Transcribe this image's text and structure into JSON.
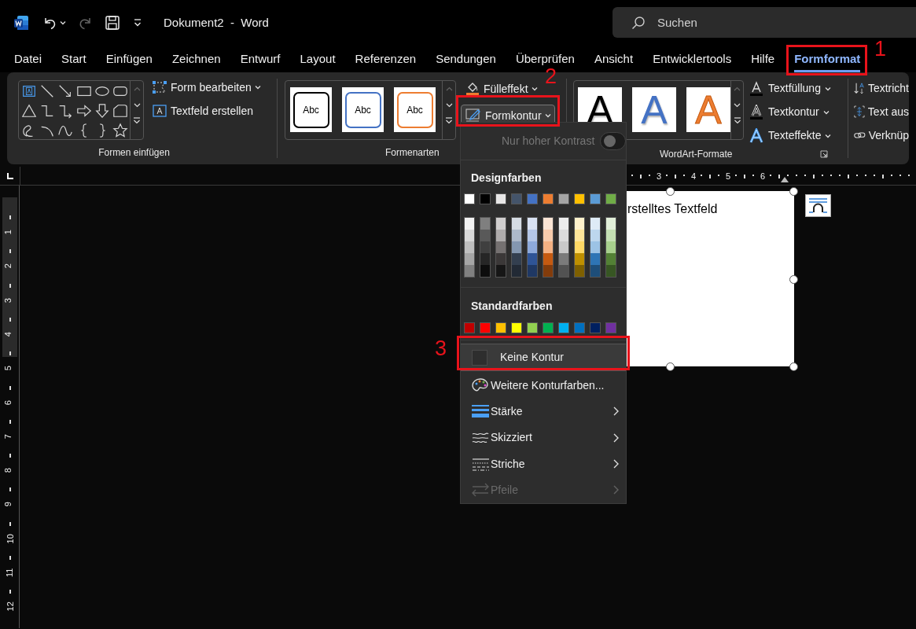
{
  "title_bar": {
    "title": "Dokument2  -  Word",
    "search": {
      "placeholder": "Suchen"
    }
  },
  "menu_tabs": [
    {
      "label": "Datei",
      "selected": false
    },
    {
      "label": "Start",
      "selected": false
    },
    {
      "label": "Einfügen",
      "selected": false
    },
    {
      "label": "Zeichnen",
      "selected": false
    },
    {
      "label": "Entwurf",
      "selected": false
    },
    {
      "label": "Layout",
      "selected": false
    },
    {
      "label": "Referenzen",
      "selected": false
    },
    {
      "label": "Sendungen",
      "selected": false
    },
    {
      "label": "Überprüfen",
      "selected": false
    },
    {
      "label": "Ansicht",
      "selected": false
    },
    {
      "label": "Entwicklertools",
      "selected": false
    },
    {
      "label": "Hilfe",
      "selected": false
    },
    {
      "label": "Formformat",
      "selected": true
    }
  ],
  "ribbon": {
    "insert_shapes": {
      "label": "Formen einfügen",
      "buttons": [
        {
          "label": "Form bearbeiten",
          "caret": true
        },
        {
          "label": "Textfeld erstellen",
          "caret": false
        }
      ]
    },
    "shape_styles": {
      "label": "Formenarten",
      "styles": [
        {
          "label": "Abc",
          "color": "#000000"
        },
        {
          "label": "Abc",
          "color": "#4472c4"
        },
        {
          "label": "Abc",
          "color": "#ed7d31"
        }
      ],
      "buttons": [
        {
          "label": "Fülleffekt",
          "pressed": false
        },
        {
          "label": "Formkontur",
          "pressed": true
        }
      ]
    },
    "wordart_styles": {
      "label": "WordArt-Formate",
      "styles": [
        {
          "label": "A",
          "kind": "solid",
          "color": "#000000"
        },
        {
          "label": "A",
          "kind": "solid",
          "color": "#4472c4"
        },
        {
          "label": "A",
          "kind": "outline",
          "color": "#ed7d31"
        }
      ],
      "buttons": [
        {
          "label": "Textfüllung"
        },
        {
          "label": "Textkontur"
        },
        {
          "label": "Texteffekte"
        }
      ]
    },
    "text": {
      "buttons": [
        {
          "label": "Textricht"
        },
        {
          "label": "Text aus"
        },
        {
          "label": "Verknüp"
        }
      ]
    }
  },
  "outline_menu": {
    "high_contrast": {
      "label": "Nur hoher Kontrast",
      "on": false,
      "disabled": true
    },
    "theme_colors": {
      "label": "Designfarben",
      "columns": [
        {
          "color": "#ffffff",
          "shades": [
            {
              "color": "#f2f2f2"
            },
            {
              "color": "#d9d9d9"
            },
            {
              "color": "#bfbfbf"
            },
            {
              "color": "#a6a6a6"
            },
            {
              "color": "#808080"
            }
          ]
        },
        {
          "color": "#000000",
          "shades": [
            {
              "color": "#7f7f7f"
            },
            {
              "color": "#595959"
            },
            {
              "color": "#3f3f3f"
            },
            {
              "color": "#262626"
            },
            {
              "color": "#0d0d0d"
            }
          ]
        },
        {
          "color": "#e7e6e6",
          "shades": [
            {
              "color": "#d0cece"
            },
            {
              "color": "#aeabab"
            },
            {
              "color": "#757171"
            },
            {
              "color": "#3b3838"
            },
            {
              "color": "#161616"
            }
          ]
        },
        {
          "color": "#44546a",
          "shades": [
            {
              "color": "#d6dce4"
            },
            {
              "color": "#adb9ca"
            },
            {
              "color": "#8497b0"
            },
            {
              "color": "#333f4f"
            },
            {
              "color": "#222a35"
            }
          ]
        },
        {
          "color": "#4472c4",
          "shades": [
            {
              "color": "#d9e2f3"
            },
            {
              "color": "#b4c6e7"
            },
            {
              "color": "#8eaadb"
            },
            {
              "color": "#2f5496"
            },
            {
              "color": "#1f3864"
            }
          ]
        },
        {
          "color": "#ed7d31",
          "shades": [
            {
              "color": "#fbe5d5"
            },
            {
              "color": "#f7cbac"
            },
            {
              "color": "#f4b183"
            },
            {
              "color": "#c55a11"
            },
            {
              "color": "#833c0b"
            }
          ]
        },
        {
          "color": "#a5a5a5",
          "shades": [
            {
              "color": "#ededed"
            },
            {
              "color": "#dbdbdb"
            },
            {
              "color": "#c9c9c9"
            },
            {
              "color": "#7b7b7b"
            },
            {
              "color": "#525252"
            }
          ]
        },
        {
          "color": "#ffc000",
          "shades": [
            {
              "color": "#fff2cc"
            },
            {
              "color": "#fee599"
            },
            {
              "color": "#ffd965"
            },
            {
              "color": "#bf9000"
            },
            {
              "color": "#7f6000"
            }
          ]
        },
        {
          "color": "#5b9bd5",
          "shades": [
            {
              "color": "#deebf6"
            },
            {
              "color": "#bdd7ee"
            },
            {
              "color": "#9cc3e5"
            },
            {
              "color": "#2e75b5"
            },
            {
              "color": "#1e4e79"
            }
          ]
        },
        {
          "color": "#70ad47",
          "shades": [
            {
              "color": "#e2efd9"
            },
            {
              "color": "#c5e0b3"
            },
            {
              "color": "#a8d08d"
            },
            {
              "color": "#538135"
            },
            {
              "color": "#375623"
            }
          ]
        }
      ]
    },
    "standard_colors": {
      "label": "Standardfarben",
      "swatches": [
        {
          "color": "#c00000"
        },
        {
          "color": "#ff0000"
        },
        {
          "color": "#ffc000"
        },
        {
          "color": "#ffff00"
        },
        {
          "color": "#92d050"
        },
        {
          "color": "#00b050"
        },
        {
          "color": "#00b0f0"
        },
        {
          "color": "#0070c0"
        },
        {
          "color": "#002060"
        },
        {
          "color": "#7030a0"
        }
      ]
    },
    "items": [
      {
        "kind": "no_outline",
        "label": "Keine Kontur",
        "highlighted": true,
        "disabled": false
      },
      {
        "kind": "dialog",
        "label": "Weitere Konturfarben...",
        "highlighted": false,
        "disabled": false
      },
      {
        "kind": "submenu",
        "label": "Stärke",
        "highlighted": false,
        "disabled": false
      },
      {
        "kind": "submenu",
        "label": "Skizziert",
        "highlighted": false,
        "disabled": false
      },
      {
        "kind": "submenu",
        "label": "Striche",
        "highlighted": false,
        "disabled": false
      },
      {
        "kind": "submenu",
        "label": "Pfeile",
        "highlighted": false,
        "disabled": true
      }
    ]
  },
  "rulers": {
    "horizontal": [
      "3",
      "4",
      "5",
      "6"
    ],
    "vertical": [
      "1",
      "2",
      "3",
      "4",
      "5",
      "6",
      "7",
      "8",
      "9",
      "10",
      "11",
      "12"
    ]
  },
  "document": {
    "text_box": {
      "text": "rstelltes Textfeld"
    }
  },
  "annotations": [
    {
      "label": "1"
    },
    {
      "label": "2"
    },
    {
      "label": "3"
    }
  ]
}
